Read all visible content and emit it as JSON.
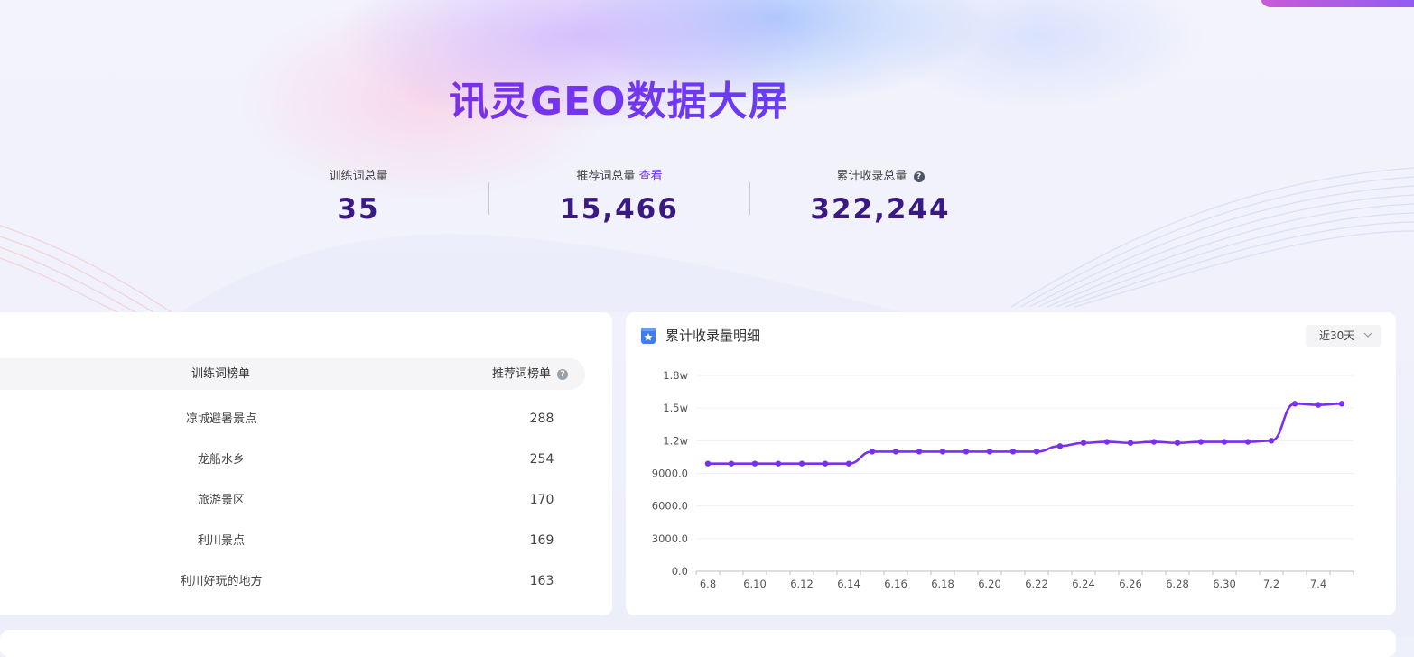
{
  "title": "讯灵GEO数据大屏",
  "stats": [
    {
      "label": "训练词总量",
      "value": "35"
    },
    {
      "label": "推荐词总量",
      "link": "查看",
      "value": "15,466"
    },
    {
      "label": "累计收录总量",
      "value": "322,244"
    }
  ],
  "ranking": {
    "col_words": "训练词榜单",
    "col_rec": "推荐词榜单",
    "rows": [
      {
        "word": "凉城避暑景点",
        "count": "288"
      },
      {
        "word": "龙船水乡",
        "count": "254"
      },
      {
        "word": "旅游景区",
        "count": "170"
      },
      {
        "word": "利川景点",
        "count": "169"
      },
      {
        "word": "利川好玩的地方",
        "count": "163"
      }
    ]
  },
  "detail": {
    "title": "累计收录量明细",
    "range": "近30天"
  },
  "colors": {
    "accent": "#6d2ff0",
    "line": "#7a2ff0",
    "value": "#3a1a82"
  },
  "chart_data": {
    "type": "line",
    "title": "累计收录量明细",
    "x": [
      "6.8",
      "6.9",
      "6.10",
      "6.11",
      "6.12",
      "6.13",
      "6.14",
      "6.15",
      "6.16",
      "6.17",
      "6.18",
      "6.19",
      "6.20",
      "6.21",
      "6.22",
      "6.23",
      "6.24",
      "6.25",
      "6.26",
      "6.27",
      "6.28",
      "6.29",
      "6.30",
      "7.1",
      "7.2",
      "7.3",
      "7.4",
      "7.5"
    ],
    "x_tick_labels": [
      "6.8",
      "6.10",
      "6.12",
      "6.14",
      "6.16",
      "6.18",
      "6.20",
      "6.22",
      "6.24",
      "6.26",
      "6.28",
      "6.30",
      "7.2",
      "7.4"
    ],
    "series": [
      {
        "values": [
          9900,
          9900,
          9900,
          9900,
          9900,
          9900,
          9900,
          11000,
          11000,
          11000,
          11000,
          11000,
          11000,
          11000,
          11000,
          11500,
          11800,
          11900,
          11800,
          11900,
          11800,
          11900,
          11900,
          11900,
          12000,
          15400,
          15300,
          15400
        ]
      }
    ],
    "y_tick_labels": [
      "0.0",
      "3000.0",
      "6000.0",
      "9000.0",
      "1.2w",
      "1.5w",
      "1.8w"
    ],
    "ylim": [
      0,
      18000
    ],
    "grid": true
  }
}
